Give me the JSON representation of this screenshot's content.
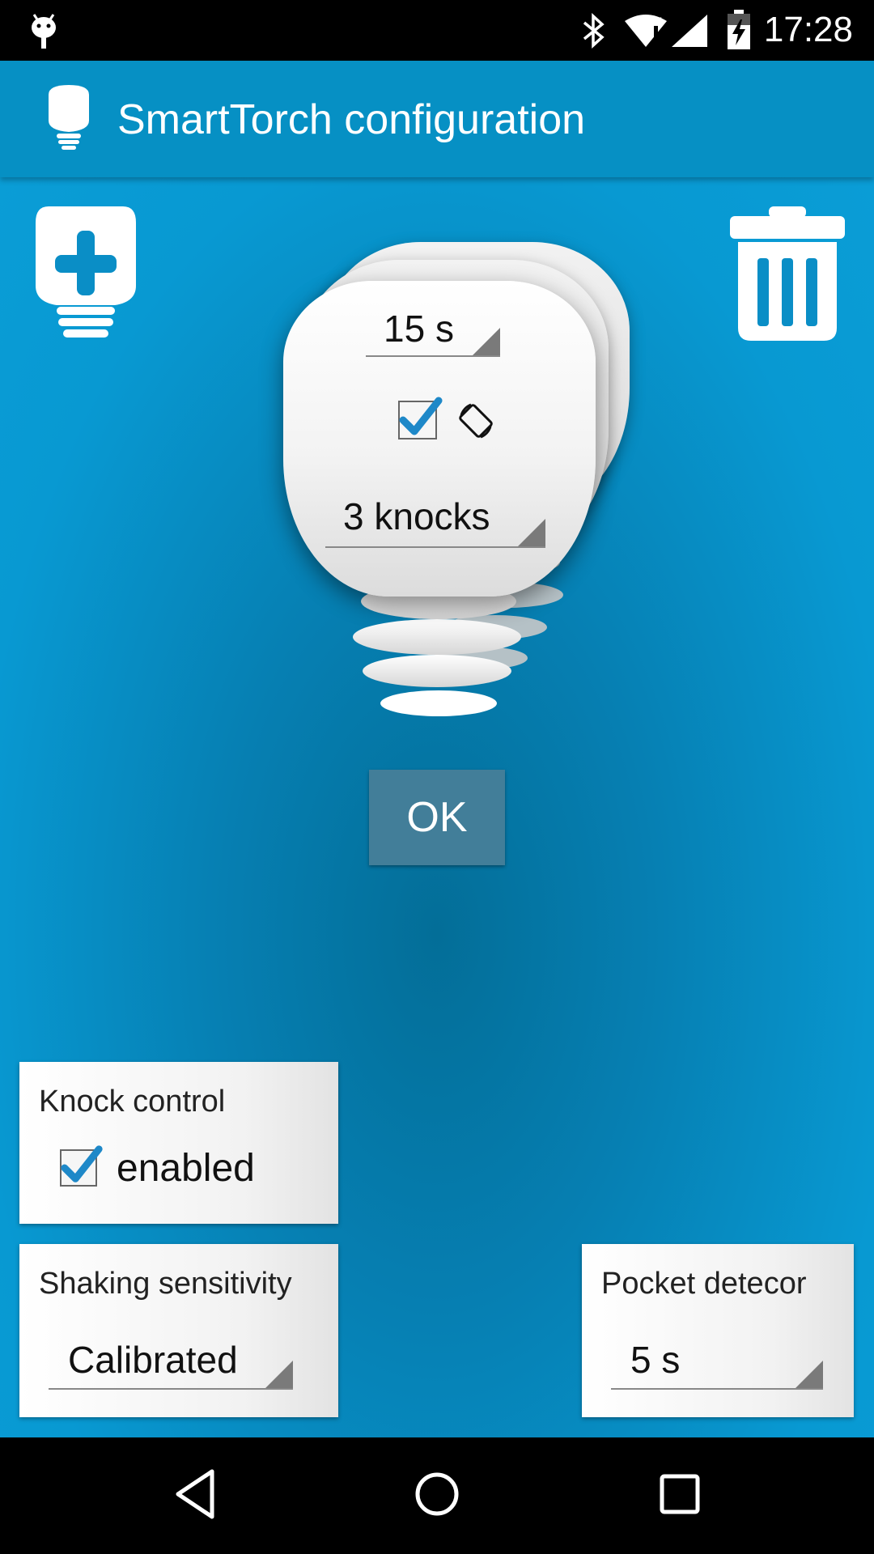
{
  "status_bar": {
    "time": "17:28",
    "icons": [
      "android-debug-icon",
      "bluetooth-icon",
      "wifi-icon",
      "signal-icon",
      "battery-charging-icon"
    ]
  },
  "app_bar": {
    "title": "SmartTorch configuration",
    "icon": "bulb-icon"
  },
  "toolbar": {
    "add_icon": "add-bulb-icon",
    "delete_icon": "trash-icon"
  },
  "torch": {
    "timeout_value": "15 s",
    "rotate_checked": true,
    "rotate_icon": "screen-rotation-icon",
    "knocks_value": "3 knocks"
  },
  "ok_label": "OK",
  "knock_control": {
    "title": "Knock control",
    "checkbox_label": "enabled",
    "checked": true
  },
  "shaking_sensitivity": {
    "title": "Shaking sensitivity",
    "value": "Calibrated"
  },
  "pocket_detector": {
    "title": "Pocket detecor",
    "value": "5 s"
  },
  "nav_bar": {
    "icons": [
      "back-icon",
      "home-icon",
      "recents-icon"
    ]
  },
  "colors": {
    "accent": "#0690c4",
    "background": "#0a9dd6",
    "ok_button": "#427e99",
    "check": "#1e88c8"
  }
}
